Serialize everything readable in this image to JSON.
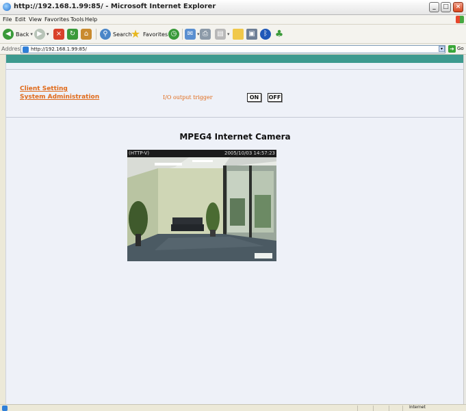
{
  "window": {
    "title": "http://192.168.1.99:85/ - Microsoft Internet Explorer",
    "controls": [
      "minimize",
      "maximize",
      "close"
    ]
  },
  "menu": [
    "File",
    "Edit",
    "View",
    "Favorites",
    "Tools",
    "Help"
  ],
  "toolbar": {
    "back_label": "Back",
    "search_label": "Search",
    "favorites_label": "Favorites"
  },
  "address": {
    "label": "Address",
    "url": "http://192.168.1.99:85/",
    "go_label": "Go"
  },
  "page": {
    "links": {
      "client_setting": "Client Setting",
      "system_administration": "System Administration"
    },
    "io": {
      "label": "I/O output trigger",
      "on": "ON",
      "off": "OFF"
    },
    "camera_title": "MPEG4 Internet Camera",
    "overlay": {
      "protocol": "(HTTP-V)",
      "timestamp": "2005/10/03 14:57:23"
    }
  },
  "status": {
    "zone": "Internet"
  },
  "colors": {
    "accent_teal": "#3d9a8f",
    "link_orange": "#e06a1a",
    "page_bg": "#eef1f8"
  }
}
